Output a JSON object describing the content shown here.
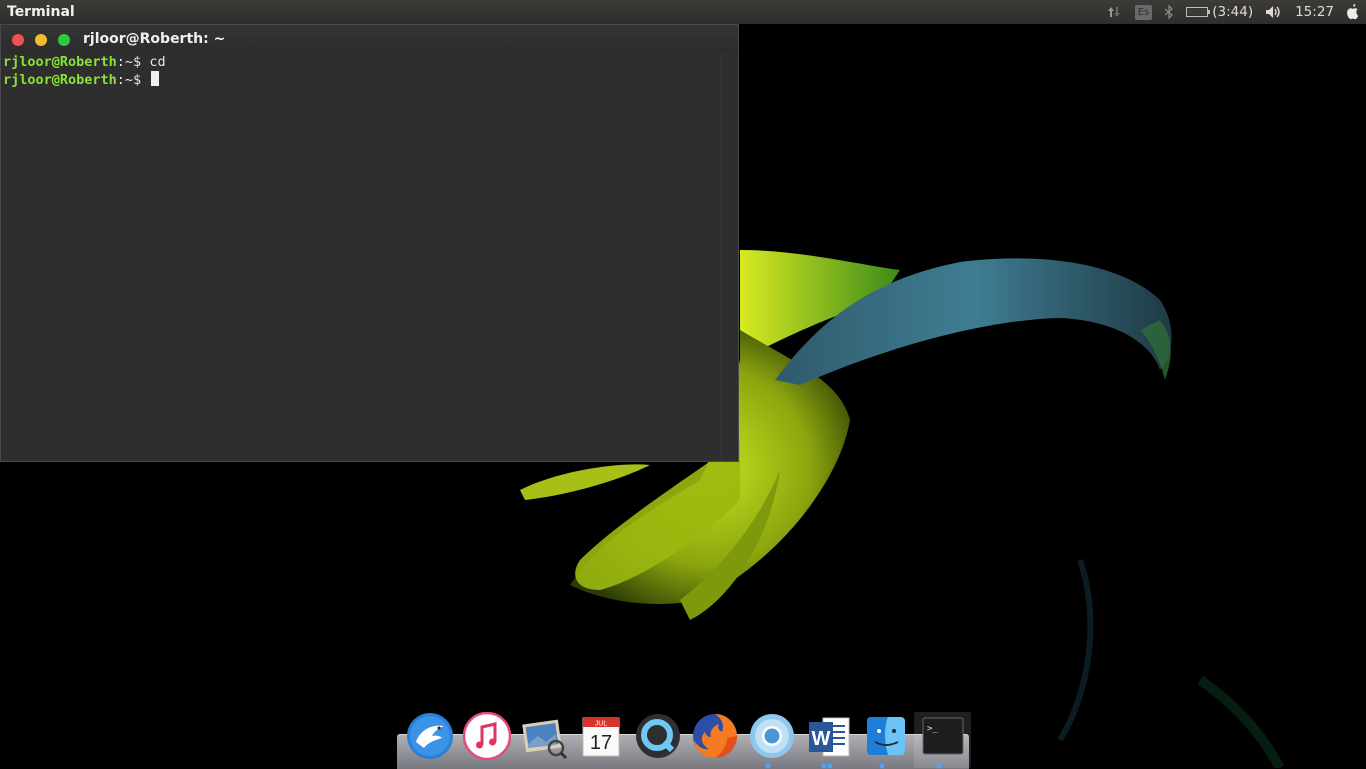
{
  "top_panel": {
    "app_title": "Terminal",
    "keyboard_layout": "Es",
    "battery_time": "(3:44)",
    "clock": "15:27"
  },
  "terminal": {
    "window_title": "rjloor@Roberth: ~",
    "lines": [
      {
        "user": "rjloor@Roberth",
        "path": ":~$ ",
        "command": "cd"
      },
      {
        "user": "rjloor@Roberth",
        "path": ":~$ ",
        "command": ""
      }
    ]
  },
  "dock": {
    "items": [
      {
        "name": "mail-app",
        "icon": "eagle-mail-icon"
      },
      {
        "name": "itunes",
        "icon": "music-note-icon"
      },
      {
        "name": "image-viewer",
        "icon": "photo-viewer-icon"
      },
      {
        "name": "calendar",
        "icon": "calendar-icon",
        "month": "JUL",
        "day": "17"
      },
      {
        "name": "quicktime",
        "icon": "quicktime-icon"
      },
      {
        "name": "firefox",
        "icon": "firefox-icon"
      },
      {
        "name": "chromium",
        "icon": "chromium-icon"
      },
      {
        "name": "word",
        "icon": "word-icon",
        "letter": "W"
      },
      {
        "name": "finder",
        "icon": "finder-icon"
      },
      {
        "name": "terminal",
        "icon": "terminal-icon",
        "glyph": ">_"
      }
    ]
  },
  "colors": {
    "prompt_user": "#8ae234",
    "panel": "#3c3b37",
    "terminal_bg": "#2e2e2e"
  }
}
